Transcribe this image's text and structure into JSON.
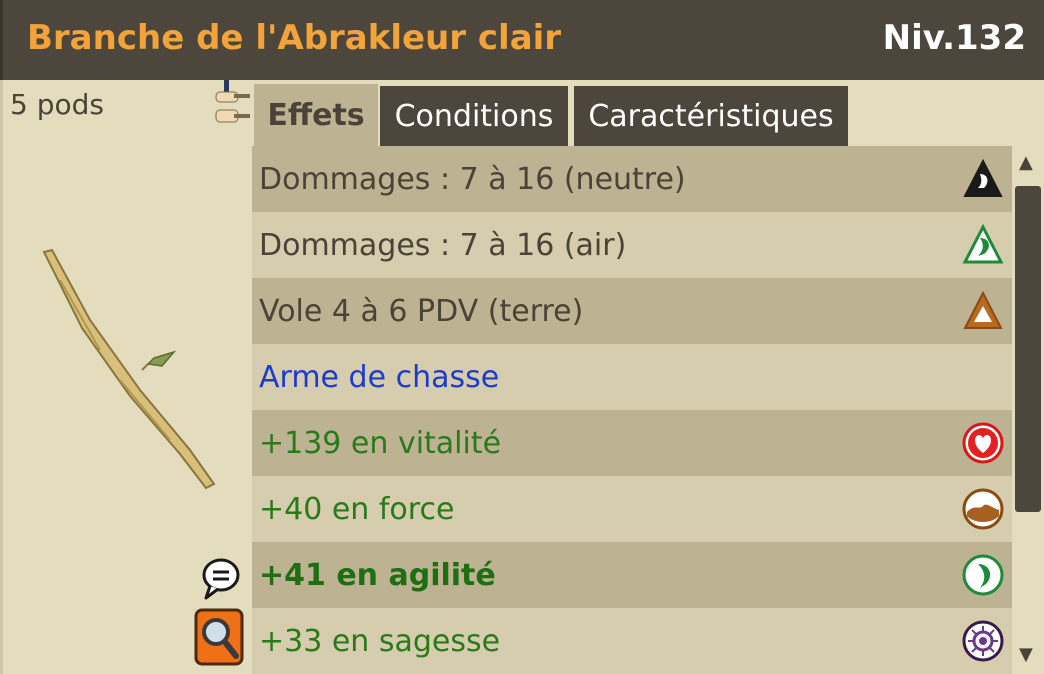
{
  "item": {
    "name": "Branche de l'Abrakleur clair",
    "level": "Niv.132",
    "weight": "5 pods"
  },
  "tabs": [
    {
      "label": "Effets",
      "active": true
    },
    {
      "label": "Conditions",
      "active": false
    },
    {
      "label": "Caractéristiques",
      "active": false
    }
  ],
  "effects": [
    {
      "text": "Dommages : 7 à 16 (neutre)",
      "icon": "neutral-element-icon"
    },
    {
      "text": "Dommages : 7 à 16 (air)",
      "icon": "air-element-icon"
    },
    {
      "text": "Vole 4 à 6 PDV (terre)",
      "icon": "earth-element-icon"
    },
    {
      "text": "Arme de chasse",
      "icon": ""
    },
    {
      "text": "+139 en vitalité",
      "icon": "vitality-icon"
    },
    {
      "text": "+40 en force",
      "icon": "strength-icon"
    },
    {
      "text": "+41 en agilité",
      "icon": "agility-icon"
    },
    {
      "text": "+33 en sagesse",
      "icon": "wisdom-icon"
    }
  ],
  "scroll": {
    "up": "▲",
    "down": "▼"
  }
}
